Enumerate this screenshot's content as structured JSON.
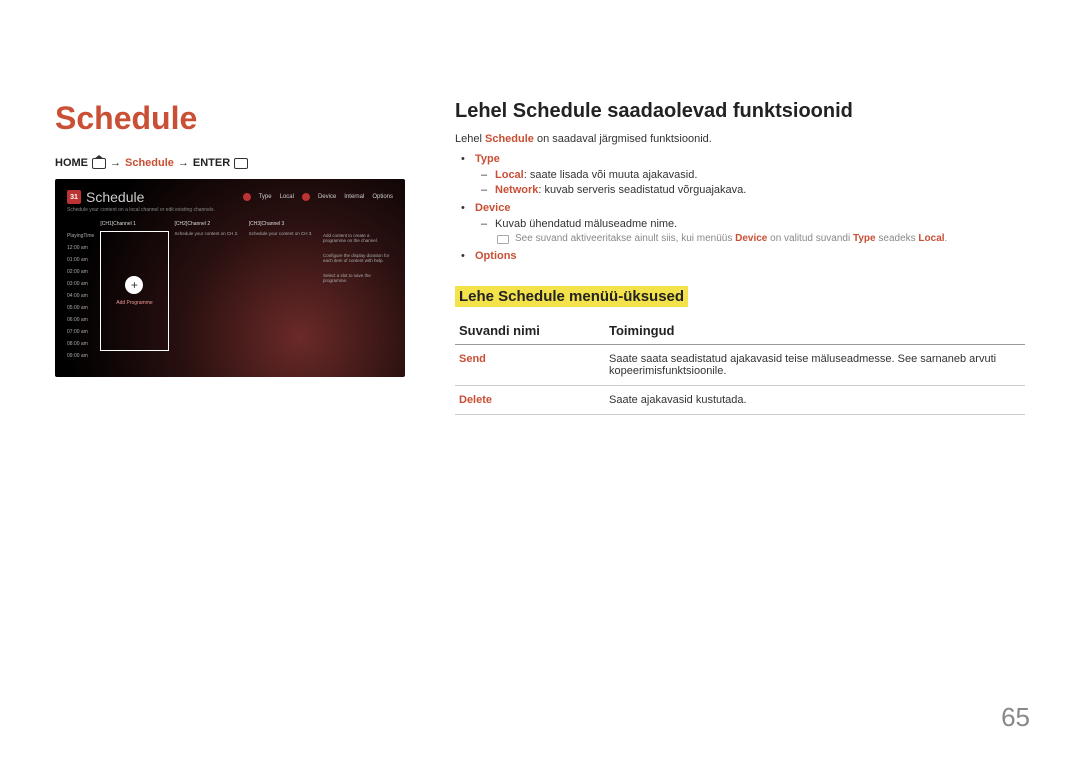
{
  "main_title": "Schedule",
  "breadcrumb": {
    "home": "HOME",
    "arrow1": "→",
    "schedule": "Schedule",
    "arrow2": "→",
    "enter": "ENTER"
  },
  "mock": {
    "cal_icon_text": "31",
    "title": "Schedule",
    "subtitle": "Schedule your content on a local channel or edit existing channels.",
    "header_type_label": "Type",
    "header_type_value": "Local",
    "header_device_label": "Device",
    "header_device_value": "Internal",
    "header_options": "Options",
    "playing_time_label": "PlayingTime",
    "times": [
      "12:00 am",
      "01:00 am",
      "02:00 am",
      "03:00 am",
      "04:00 am",
      "05:00 am",
      "06:00 am",
      "07:00 am",
      "08:00 am",
      "09:00 am"
    ],
    "col1_head": "[CH1]Channel 1",
    "col2_head": "[CH2]Channel 2",
    "col3_head": "[CH3]Channel 3",
    "add_plus": "+",
    "add_label": "Add Programme",
    "col2_desc": "Schedule your content on CH 2.",
    "col3_desc": "Schedule your content on CH 3.",
    "side1": "Add content to create a programme on the channel.",
    "side2": "Configure the display duration for each item of content with help.",
    "side3": "Select a slot to save the programme."
  },
  "section_title": "Lehel Schedule saadaolevad funktsioonid",
  "intro": {
    "pre": "Lehel ",
    "strong": "Schedule",
    "post": " on saadaval järgmised funktsioonid."
  },
  "bullets": {
    "type": {
      "label": "Type",
      "local_head": "Local",
      "local_text": ": saate lisada või muuta ajakavasid.",
      "network_head": "Network",
      "network_text": ": kuvab serveris seadistatud võrguajakava."
    },
    "device": {
      "label": "Device",
      "text": "Kuvab ühendatud mäluseadme nime.",
      "note_pre": "See suvand aktiveeritakse ainult siis, kui menüüs ",
      "note_device": "Device",
      "note_mid": " on valitud suvandi ",
      "note_type": "Type",
      "note_mid2": " seadeks ",
      "note_local": "Local",
      "note_end": "."
    },
    "options": {
      "label": "Options"
    }
  },
  "highlight_title": "Lehe Schedule menüü-üksused",
  "table": {
    "head_name": "Suvandi nimi",
    "head_action": "Toimingud",
    "rows": [
      {
        "name": "Send",
        "action": "Saate saata seadistatud ajakavasid teise mäluseadmesse. See sarnaneb arvuti kopeerimisfunktsioonile."
      },
      {
        "name": "Delete",
        "action": "Saate ajakavasid kustutada."
      }
    ]
  },
  "page_number": "65"
}
